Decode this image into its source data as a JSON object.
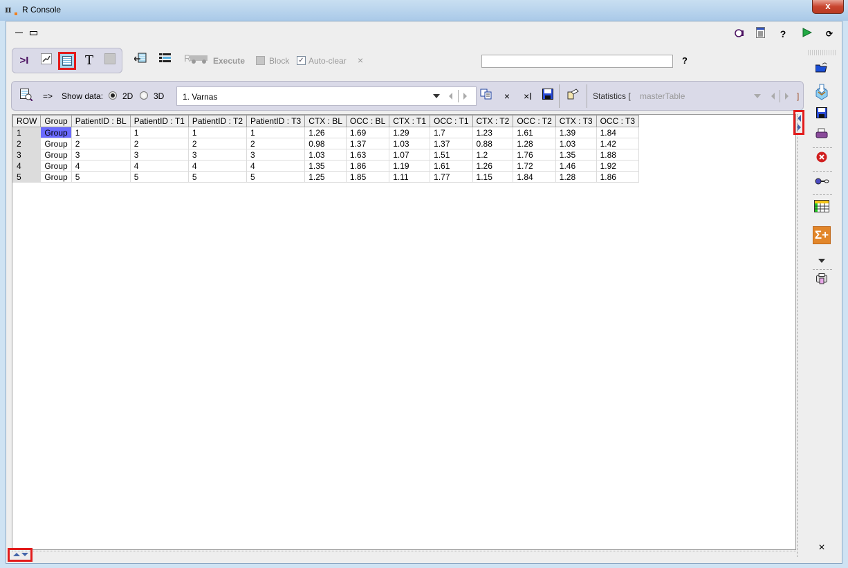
{
  "window": {
    "title": "R Console",
    "close_label": "x"
  },
  "top_icons": [
    "record-icon",
    "script-icon",
    "help-icon",
    "run-icon",
    "refresh-icon"
  ],
  "top_help": "?",
  "toolbar": {
    "modes": [
      "console-mode",
      "plot-mode",
      "table-mode",
      "text-mode",
      "blank-mode"
    ],
    "selected_mode": "table-mode",
    "execute_label": "Execute",
    "block_label": "Block",
    "block_checked": false,
    "autoclear_label": "Auto-clear",
    "autoclear_checked": true,
    "clear_label": "×",
    "search_value": "",
    "help_label": "?"
  },
  "data_panel": {
    "arrow_label": "=>",
    "show_data_label": "Show data:",
    "options": [
      "2D",
      "3D"
    ],
    "selected_option": "2D",
    "data_select_value": "1. Varnas",
    "statistics_label": "Statistics [",
    "statistics_value": "masterTable",
    "statistics_close": "]"
  },
  "table": {
    "columns": [
      "ROW",
      "Group",
      "PatientID : BL",
      "PatientID : T1",
      "PatientID : T2",
      "PatientID : T3",
      "CTX : BL",
      "OCC : BL",
      "CTX : T1",
      "OCC : T1",
      "CTX : T2",
      "OCC : T2",
      "CTX : T3",
      "OCC : T3"
    ],
    "rows": [
      [
        "1",
        "Group",
        "1",
        "1",
        "1",
        "1",
        "1.26",
        "1.69",
        "1.29",
        "1.7",
        "1.23",
        "1.61",
        "1.39",
        "1.84"
      ],
      [
        "2",
        "Group",
        "2",
        "2",
        "2",
        "2",
        "0.98",
        "1.37",
        "1.03",
        "1.37",
        "0.88",
        "1.28",
        "1.03",
        "1.42"
      ],
      [
        "3",
        "Group",
        "3",
        "3",
        "3",
        "3",
        "1.03",
        "1.63",
        "1.07",
        "1.51",
        "1.2",
        "1.76",
        "1.35",
        "1.88"
      ],
      [
        "4",
        "Group",
        "4",
        "4",
        "4",
        "4",
        "1.35",
        "1.86",
        "1.19",
        "1.61",
        "1.26",
        "1.72",
        "1.46",
        "1.92"
      ],
      [
        "5",
        "Group",
        "5",
        "5",
        "5",
        "5",
        "1.25",
        "1.85",
        "1.11",
        "1.77",
        "1.15",
        "1.84",
        "1.28",
        "1.86"
      ]
    ],
    "selected_cell": {
      "row": 0,
      "col": 1
    }
  },
  "right_bar": {
    "items": [
      "open-folder-icon",
      "import-icon",
      "save-icon",
      "print-icon",
      "delete-icon",
      "connect-icon",
      "table-icon",
      "sum-add-icon",
      "more-icon",
      "printer-icon"
    ],
    "close_label": "×"
  },
  "colors": {
    "highlight": "#6a6aff",
    "mark": "#e21b1b"
  }
}
